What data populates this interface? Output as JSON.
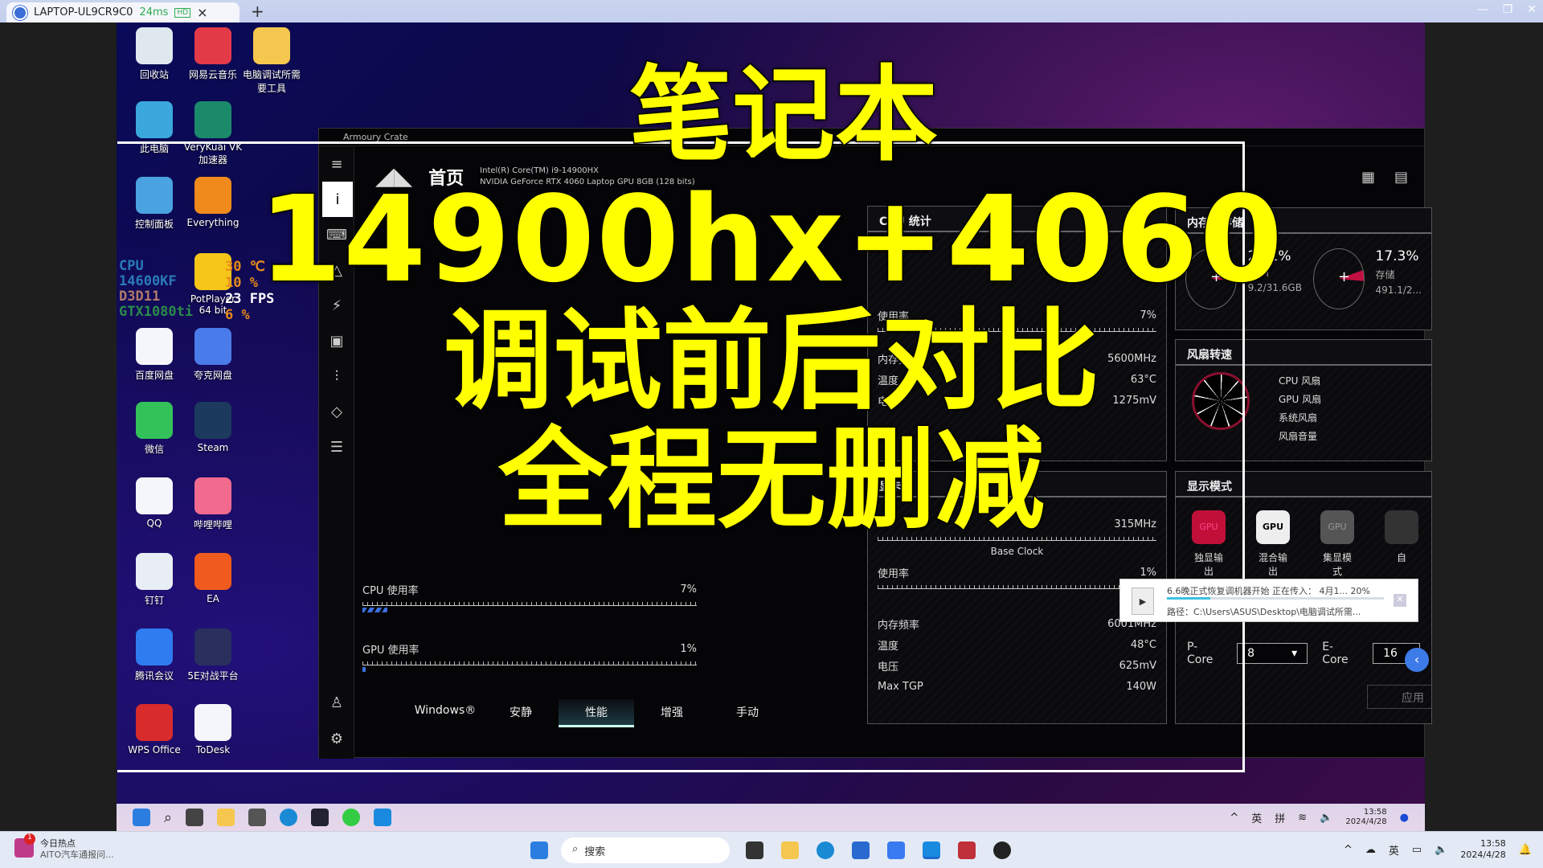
{
  "remote_tab": {
    "host": "LAPTOP-UL9CR9C0",
    "ping": "24ms",
    "quality": "HD",
    "close": "×",
    "new_tab": "+",
    "window_controls": [
      "—",
      "❐",
      "✕"
    ]
  },
  "desktop_icons": [
    {
      "label": "回收站",
      "color": "#dfe8ef"
    },
    {
      "label": "网易云音乐",
      "color": "#e33a48"
    },
    {
      "label": "电脑调试所需要工具",
      "color": "#f5c74e"
    },
    {
      "label": "此电脑",
      "color": "#3aa8dc"
    },
    {
      "label": "VeryKuai VK 加速器",
      "color": "#1b8a6b"
    },
    {
      "label": "控制面板",
      "color": "#4aa3e0"
    },
    {
      "label": "Everything",
      "color": "#f08a1c"
    },
    {
      "label": "PotPlayer 64 bit",
      "color": "#f5c518"
    },
    {
      "label": "百度网盘",
      "color": "#f4f6fb"
    },
    {
      "label": "夸克网盘",
      "color": "#4a7bea"
    },
    {
      "label": "微信",
      "color": "#33c25a"
    },
    {
      "label": "Steam",
      "color": "#1b3a5e"
    },
    {
      "label": "QQ",
      "color": "#f4f6fb"
    },
    {
      "label": "哔哩哔哩",
      "color": "#f26b8f"
    },
    {
      "label": "钉钉",
      "color": "#e9eef5"
    },
    {
      "label": "EA",
      "color": "#f05a1c"
    },
    {
      "label": "腾讯会议",
      "color": "#2f7cf0"
    },
    {
      "label": "5E对战平台",
      "color": "#2a2f5e"
    },
    {
      "label": "WPS Office",
      "color": "#d82b2b"
    },
    {
      "label": "ToDesk",
      "color": "#f4f6fb"
    }
  ],
  "hud": {
    "lines": [
      "CPU",
      "14600KF",
      "D3D11",
      "GTX1080ti"
    ],
    "values": [
      "30 ℃",
      "10 %",
      "23 FPS",
      "6 %"
    ]
  },
  "app": {
    "title": "Armoury Crate",
    "page": "首页",
    "cpu_name": "Intel(R) Core(TM) i9-14900HX",
    "gpu_name": "NVIDIA GeForce RTX 4060 Laptop GPU 8GB (128 bits)",
    "cpu_panel": {
      "title": "CPU 统计",
      "usage_label": "使用率",
      "usage": "7%",
      "rows": [
        {
          "label": "内存频率",
          "value": "5600MHz"
        },
        {
          "label": "温度",
          "value": "63°C"
        },
        {
          "label": "电压",
          "value": "1275mV"
        }
      ]
    },
    "gpu_panel": {
      "title": "显卡",
      "clock": "315MHz",
      "base_clock": "Base Clock",
      "usage_label": "使用率",
      "usage": "1%",
      "rows": [
        {
          "label": "内存频率",
          "value": "6001MHz"
        },
        {
          "label": "温度",
          "value": "48°C"
        },
        {
          "label": "电压",
          "value": "625mV"
        },
        {
          "label": "Max TGP",
          "value": "140W"
        }
      ]
    },
    "memory_panel": {
      "title": "内存和存储",
      "ram_pct": "29.1%",
      "ram_label": "RAM",
      "ram_detail": "9.2/31.6GB",
      "storage_pct": "17.3%",
      "storage_label": "存储",
      "storage_detail": "491.1/2..."
    },
    "fan_panel": {
      "title": "风扇转速",
      "items": [
        "CPU 风扇",
        "GPU 风扇",
        "系统风扇",
        "风扇音量"
      ]
    },
    "display_panel": {
      "title": "显示模式",
      "modes": [
        "独显输出",
        "混合输出",
        "集显模式",
        "自"
      ],
      "pcore_label": "P-Core",
      "pcore": "8",
      "ecore_label": "E-Core",
      "ecore": "16",
      "apply": "应用"
    },
    "cpu_usage_label": "CPU 使用率",
    "cpu_usage": "7%",
    "cpu_usage_value": 7,
    "gpu_usage_label": "GPU 使用率",
    "gpu_usage": "1%",
    "gpu_usage_value": 1,
    "modes": [
      "Windows®",
      "安静",
      "性能",
      "增强",
      "手动"
    ],
    "active_mode": "性能"
  },
  "overlay_text": [
    "笔记本",
    "14900hx+4060",
    "调试前后对比",
    "全程无删减"
  ],
  "notification": {
    "title": "6.6晚正式恢复调机器开始 正在传入： 4月1... 20%",
    "path": "路径：C:\\Users\\ASUS\\Desktop\\电脑调试所需...",
    "progress": 20
  },
  "remote_taskbar": {
    "tray": [
      "英",
      "拼"
    ],
    "time": "13:58",
    "date": "2024/4/28"
  },
  "taskbar": {
    "news_badge": "1",
    "news_title": "今日热点",
    "news_sub": "AITO汽车通报问...",
    "search": "搜索",
    "tray_lang": "英",
    "time": "13:58",
    "date": "2024/4/28"
  }
}
